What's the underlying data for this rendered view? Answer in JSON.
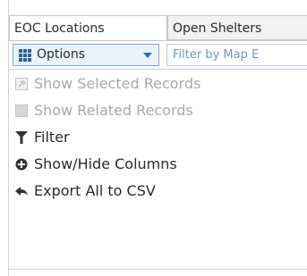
{
  "tabs": [
    {
      "label": "EOC Locations",
      "active": true
    },
    {
      "label": "Open Shelters",
      "active": false
    }
  ],
  "toolbar": {
    "options_label": "Options",
    "filter_text": "Filter by Map E"
  },
  "menu": {
    "items": [
      {
        "label": "Show Selected Records",
        "icon": "pin-icon",
        "enabled": false
      },
      {
        "label": "Show Related Records",
        "icon": "related-records-icon",
        "enabled": false
      },
      {
        "label": "Filter",
        "icon": "funnel-icon",
        "enabled": true
      },
      {
        "label": "Show/Hide Columns",
        "icon": "plus-circle-icon",
        "enabled": true
      },
      {
        "label": "Export All to CSV",
        "icon": "export-arrow-icon",
        "enabled": true
      }
    ]
  },
  "colors": {
    "accent": "#2e6fb8",
    "disabled_text": "#a8a8a8",
    "button_bg": "#eaf2fc"
  }
}
